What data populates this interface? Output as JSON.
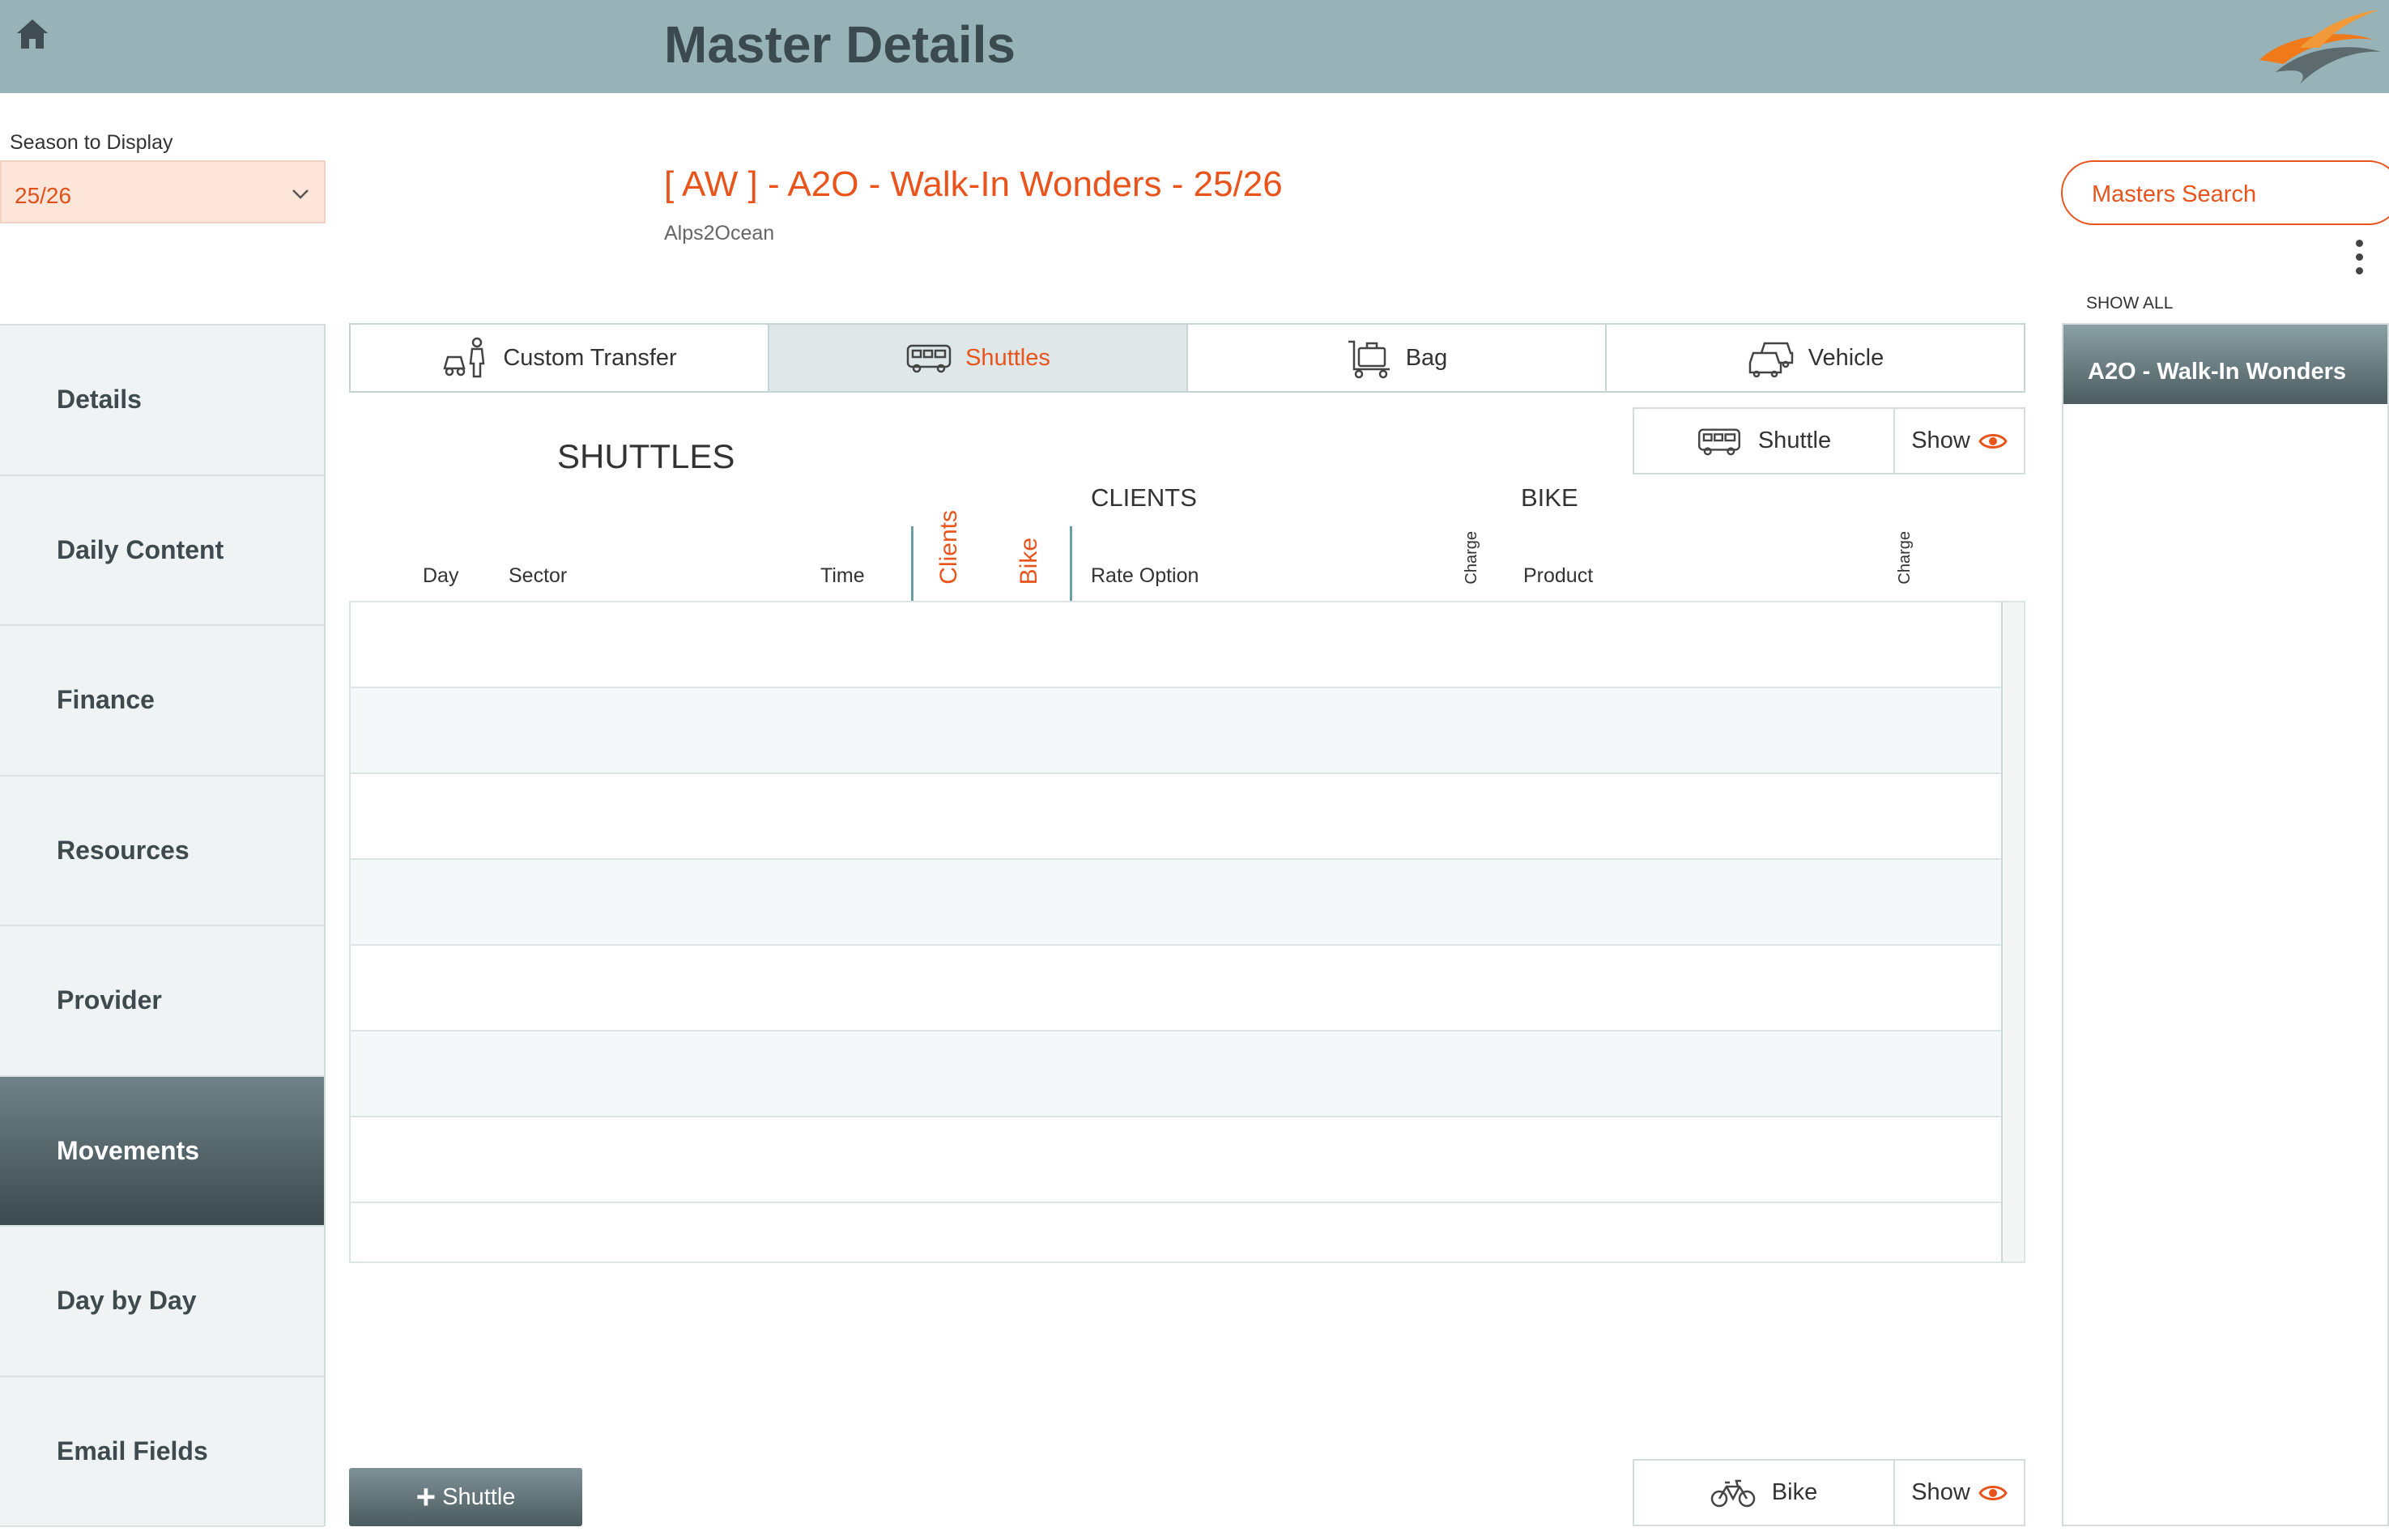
{
  "header": {
    "title": "Master Details"
  },
  "season": {
    "label": "Season to Display",
    "value": "25/26"
  },
  "master": {
    "title": "[ AW ] - A2O - Walk-In Wonders - 25/26",
    "subtitle": "Alps2Ocean"
  },
  "search": {
    "label": "Masters Search"
  },
  "sidebar": {
    "items": [
      {
        "label": "Details"
      },
      {
        "label": "Daily Content"
      },
      {
        "label": "Finance"
      },
      {
        "label": "Resources"
      },
      {
        "label": "Provider"
      },
      {
        "label": "Movements"
      },
      {
        "label": "Day by Day"
      },
      {
        "label": "Email Fields"
      }
    ],
    "active": "Movements"
  },
  "tabs": [
    {
      "label": "Custom Transfer",
      "icon": "person-car-icon"
    },
    {
      "label": "Shuttles",
      "icon": "bus-icon"
    },
    {
      "label": "Bag",
      "icon": "luggage-cart-icon"
    },
    {
      "label": "Vehicle",
      "icon": "vehicles-icon"
    }
  ],
  "active_tab": "Shuttles",
  "shuttle_filter": {
    "label": "Shuttle",
    "show": "Show"
  },
  "bike_filter": {
    "label": "Bike",
    "show": "Show"
  },
  "table": {
    "title": "SHUTTLES",
    "group_clients": "CLIENTS",
    "group_bike": "BIKE",
    "columns": {
      "day": "Day",
      "sector": "Sector",
      "time": "Time",
      "clients": "Clients",
      "bike": "Bike",
      "rate_option": "Rate Option",
      "charge1": "Charge",
      "product": "Product",
      "charge2": "Charge"
    }
  },
  "right_panel": {
    "show_all": "SHOW ALL",
    "items": [
      "A2O - Walk-In Wonders"
    ]
  },
  "add_button": {
    "label": "Shuttle"
  },
  "colors": {
    "accent": "#e8541c",
    "header": "#97b3b7",
    "active_nav": "#4c5c60"
  }
}
